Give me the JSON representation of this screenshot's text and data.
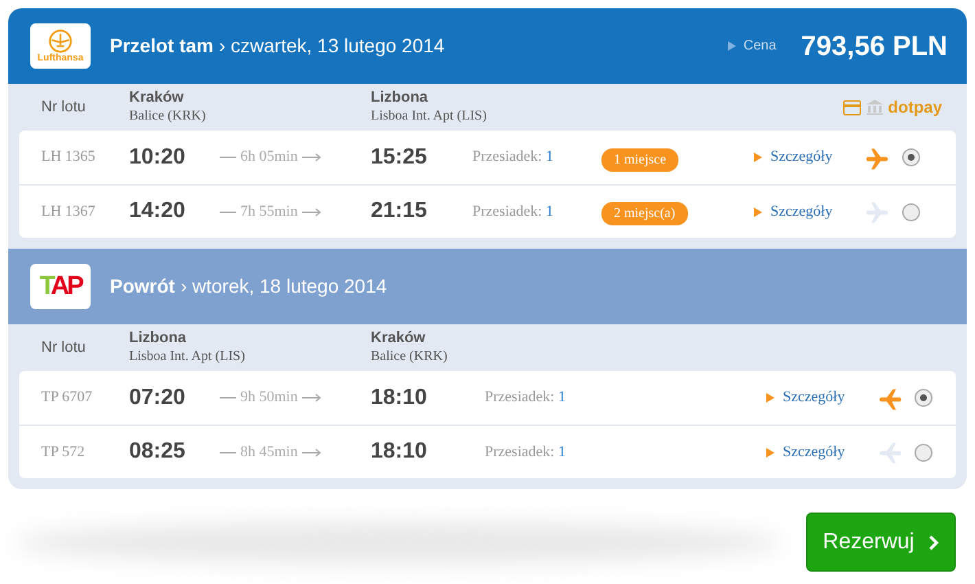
{
  "price": {
    "label": "Cena",
    "value": "793,56 PLN"
  },
  "sections": [
    {
      "kind": "outbound",
      "logo_text": "Lufthansa",
      "title": "Przelot tam",
      "date": "› czwartek, 13 lutego 2014",
      "col_flight": "Nr lotu",
      "from_city": "Kraków",
      "from_airport": "Balice (KRK)",
      "to_city": "Lizbona",
      "to_airport": "Lisboa Int. Apt (LIS)",
      "payment_text": "dotpay",
      "flights": [
        {
          "number": "LH 1365",
          "dep": "10:20",
          "duration": "6h 05min",
          "arr": "15:25",
          "stops_label": "Przesiadek:",
          "stops": "1",
          "seats": "1 miejsce",
          "details": "Szczegóły",
          "selected": true
        },
        {
          "number": "LH 1367",
          "dep": "14:20",
          "duration": "7h 55min",
          "arr": "21:15",
          "stops_label": "Przesiadek:",
          "stops": "1",
          "seats": "2 miejsc(a)",
          "details": "Szczegóły",
          "selected": false
        }
      ]
    },
    {
      "kind": "return",
      "logo_text": "TAP",
      "title": "Powrót",
      "date": "› wtorek, 18 lutego 2014",
      "col_flight": "Nr lotu",
      "from_city": "Lizbona",
      "from_airport": "Lisboa Int. Apt (LIS)",
      "to_city": "Kraków",
      "to_airport": "Balice (KRK)",
      "flights": [
        {
          "number": "TP 6707",
          "dep": "07:20",
          "duration": "9h 50min",
          "arr": "18:10",
          "stops_label": "Przesiadek:",
          "stops": "1",
          "details": "Szczegóły",
          "selected": true
        },
        {
          "number": "TP 572",
          "dep": "08:25",
          "duration": "8h 45min",
          "arr": "18:10",
          "stops_label": "Przesiadek:",
          "stops": "1",
          "details": "Szczegóły",
          "selected": false
        }
      ]
    }
  ],
  "book_button": "Rezerwuj"
}
